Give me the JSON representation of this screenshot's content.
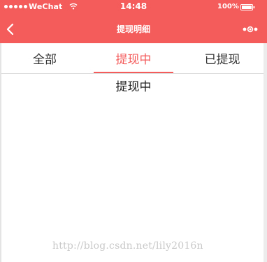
{
  "status_bar": {
    "carrier": "WeChat",
    "time": "14:48",
    "battery": "100%"
  },
  "nav": {
    "title": "提现明细"
  },
  "tabs": [
    {
      "label": "全部",
      "active": false
    },
    {
      "label": "提现中",
      "active": true
    },
    {
      "label": "已提现",
      "active": false
    }
  ],
  "content": {
    "label": "提现中"
  },
  "watermark": "http://blog.csdn.net/lily2016n",
  "colors": {
    "accent": "#f45c5c",
    "text": "#333333",
    "divider": "#dddddd"
  },
  "icons": {
    "back": "back-icon",
    "more": "more-icon",
    "wifi": "wifi-icon",
    "battery": "battery-icon",
    "signal": "signal-icon"
  }
}
